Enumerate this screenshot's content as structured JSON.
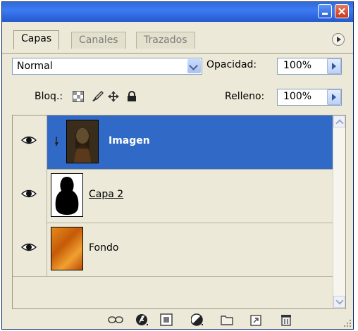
{
  "tabs": [
    {
      "label": "Capas",
      "active": true
    },
    {
      "label": "Canales",
      "active": false
    },
    {
      "label": "Trazados",
      "active": false
    }
  ],
  "blend": {
    "value": "Normal"
  },
  "opacity": {
    "label": "Opacidad:",
    "value": "100%"
  },
  "lock": {
    "label": "Bloq.:"
  },
  "fill": {
    "label": "Relleno:",
    "value": "100%"
  },
  "layers": [
    {
      "name": "Imagen",
      "selected": true,
      "visible": true,
      "clipped": true
    },
    {
      "name": "Capa 2",
      "selected": false,
      "visible": true,
      "clipped": false
    },
    {
      "name": "Fondo",
      "selected": false,
      "visible": true,
      "clipped": false
    }
  ],
  "colors": {
    "selection": "#3169c6",
    "panel": "#ece9d8",
    "titlebar": "#2e6ad8"
  },
  "footer_icons": [
    "link-layers-icon",
    "layer-style-icon",
    "layer-mask-icon",
    "adjustment-layer-icon",
    "new-group-icon",
    "new-layer-icon",
    "delete-layer-icon"
  ]
}
